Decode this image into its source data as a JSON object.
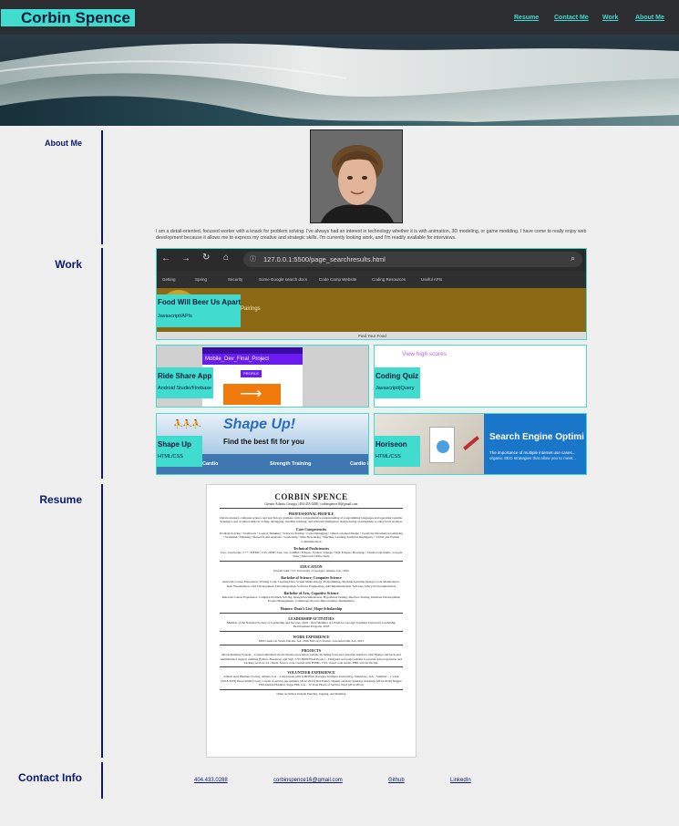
{
  "header": {
    "brand": "Corbin Spence",
    "nav": [
      "Resume",
      "Contact Me",
      "Work",
      "About Me"
    ]
  },
  "sections": {
    "about": "About Me",
    "work": "Work",
    "resume": "Resume",
    "contact": "Contact Info"
  },
  "about": {
    "bio": "I am a detail-oriented, focused worker with a knack for problem solving. I've always had an interest in technology whether it is with animation, 3D modeling, or game modding. I have come to really enjoy web development because it allows me to express my creative and strategic skills. I'm currently looking work, and I'm readily available for interviews."
  },
  "work": {
    "featured": {
      "title": "Food Will Beer Us Apart",
      "tech": "Javascript/APIs",
      "url": "127.0.0.1:5500/page_searchresults.html",
      "bookmarks": [
        "Getting",
        "Spring",
        "Security",
        "Some Google search docs",
        "Code Camp Website",
        "Coding Resources",
        "Useful APIs"
      ],
      "overlay": "Pairings",
      "footer": "Find Your Food"
    },
    "projects": [
      {
        "title": "Ride Share App",
        "tech": "Android Studio/Firebase",
        "screen_title": "Mobile_Dev_Final_Project",
        "screen_button": "PROFILE"
      },
      {
        "title": "Coding Quiz",
        "tech": "Javascript/jQuery",
        "link": "View high scores"
      },
      {
        "title": "Shape Up",
        "tech": "HTML/CSS",
        "banner_title": "Shape Up!",
        "banner_sub": "Find the best fit for you",
        "menu": [
          "Cardio",
          "Strength Training",
          "Cardio I"
        ]
      },
      {
        "title": "Horiseon",
        "tech": "HTML/CSS",
        "banner_title": "Search Engine Optimi",
        "banner_sub": "The importance of multiple internet use cases...",
        "banner_sub2": "organic SEO strategies that allow you to meet..."
      }
    ]
  },
  "resume": {
    "name": "CORBIN SPENCE",
    "contact": "Greater Atlanta, Georgia | 404-433-0288 | corbinspence16@gmail.com",
    "sections": [
      {
        "head": "PROFESSIONAL PROFILE",
        "body": "Detail-oriented, computer science and psychology graduate with a comprehensive understanding of programming languages and operating systems. Seeking to use acquired skills in coding, debugging, machine learning, and artificial intelligence design during an internship or entry-level position."
      },
      {
        "head": "Core Competencies",
        "body": "Problem Solving • Teamwork • Logical Thinking • Software Testing • Code Debugging • Object-oriented Design • Creativity Information Gathering • Systematic Thinking • Research and Analysis • Leadership • Data Structuring • Machine Learning Artificial Intelligence • Verbal and Written Communication"
      },
      {
        "head": "Technical Proficiencies",
        "body": "Java | JavaScript | C++ | HTML | CSS | PHP | Vue | Git | GitHub | Eclipse | Python | Django | SQL Eclipse | Bootstrap | Visual Code Studio | Google Suite | Microsoft Office Suite"
      },
      {
        "head": "EDUCATION",
        "body": "Overall GPA: 3.6 | University of Georgia | Athens, GA | 2022"
      },
      {
        "head": "Bachelor of Science, Computer Science",
        "body": "Relevant Course Experience: Writing Code, Creating Data, Scrum Methodology, Programming, Machine Learning Design, Code Maintenance, Data Visualization, GUI Development, Data Integration, Software Engineering, API Implementation, Software Lifecycle Documentation"
      },
      {
        "head": "Bachelor of Arts, Cognitive Science",
        "body": "Relevant Course Experience: Complex Problem Solving, Design Documentation, Hypothesis Testing, Interface Testing, Database Development, Project Management, Continuous Process Improvement, Mathematics"
      },
      {
        "head": "Honors: Dean's List | Hope Scholarship",
        "body": ""
      },
      {
        "head": "LEADERSHIP ACTIVITIES",
        "body": "Member of the National Society of Leadership and Success, 2018 - 2022 Member of LEAD for Georgia Southern University Leadership Development Program, 2018"
      },
      {
        "head": "WORK EXPERIENCE",
        "body": "Mill Creek Car Wash, Dacula, GA, 2020 McCray's Tavern, Lawrenceville, GA, 2021"
      },
      {
        "head": "PROJECTS",
        "body": "Movie Ranking System – Created simulated movie theater association website including front-end customer interface with Django and back-end administrator support utilizing Python, Bootstrap, and SQL. CSCI6260 Final Project – Designed web page website to provide gait progression and tracking services for clients. Source code created with HTML, CSS, visual code studio, PHP, and JavaScript."
      },
      {
        "head": "VOLUNTEER EXPERIENCE",
        "body": "Athens Area Humane Society, Athens, GA – 3 days/week (2021) BLBLK (Georgia Southern University), Statesboro, GA – Summer – 1 week (2018-2019) Heart Walk (Cross) 1 week of service per summer (2012-2014) Dad Pantry, Weekly services Saturday mornings (2014-2016) Nugget Hill Animal Hospital, Sugar Hill, GA – 12 Total Hours of Service Total (2012-2014)"
      },
      {
        "head": "",
        "body": "Other Activities Include Fencing, Jogging, and Running"
      }
    ]
  },
  "contact": {
    "phone": "404.433.0288",
    "email": "corbinspence16@gmail.com",
    "github": "Github",
    "linkedin": "LinkedIn"
  },
  "colors": {
    "accent": "#40dcd0",
    "header_bg": "#2b2d31",
    "navy": "#0b1a6e",
    "page_bg": "#efefef"
  }
}
